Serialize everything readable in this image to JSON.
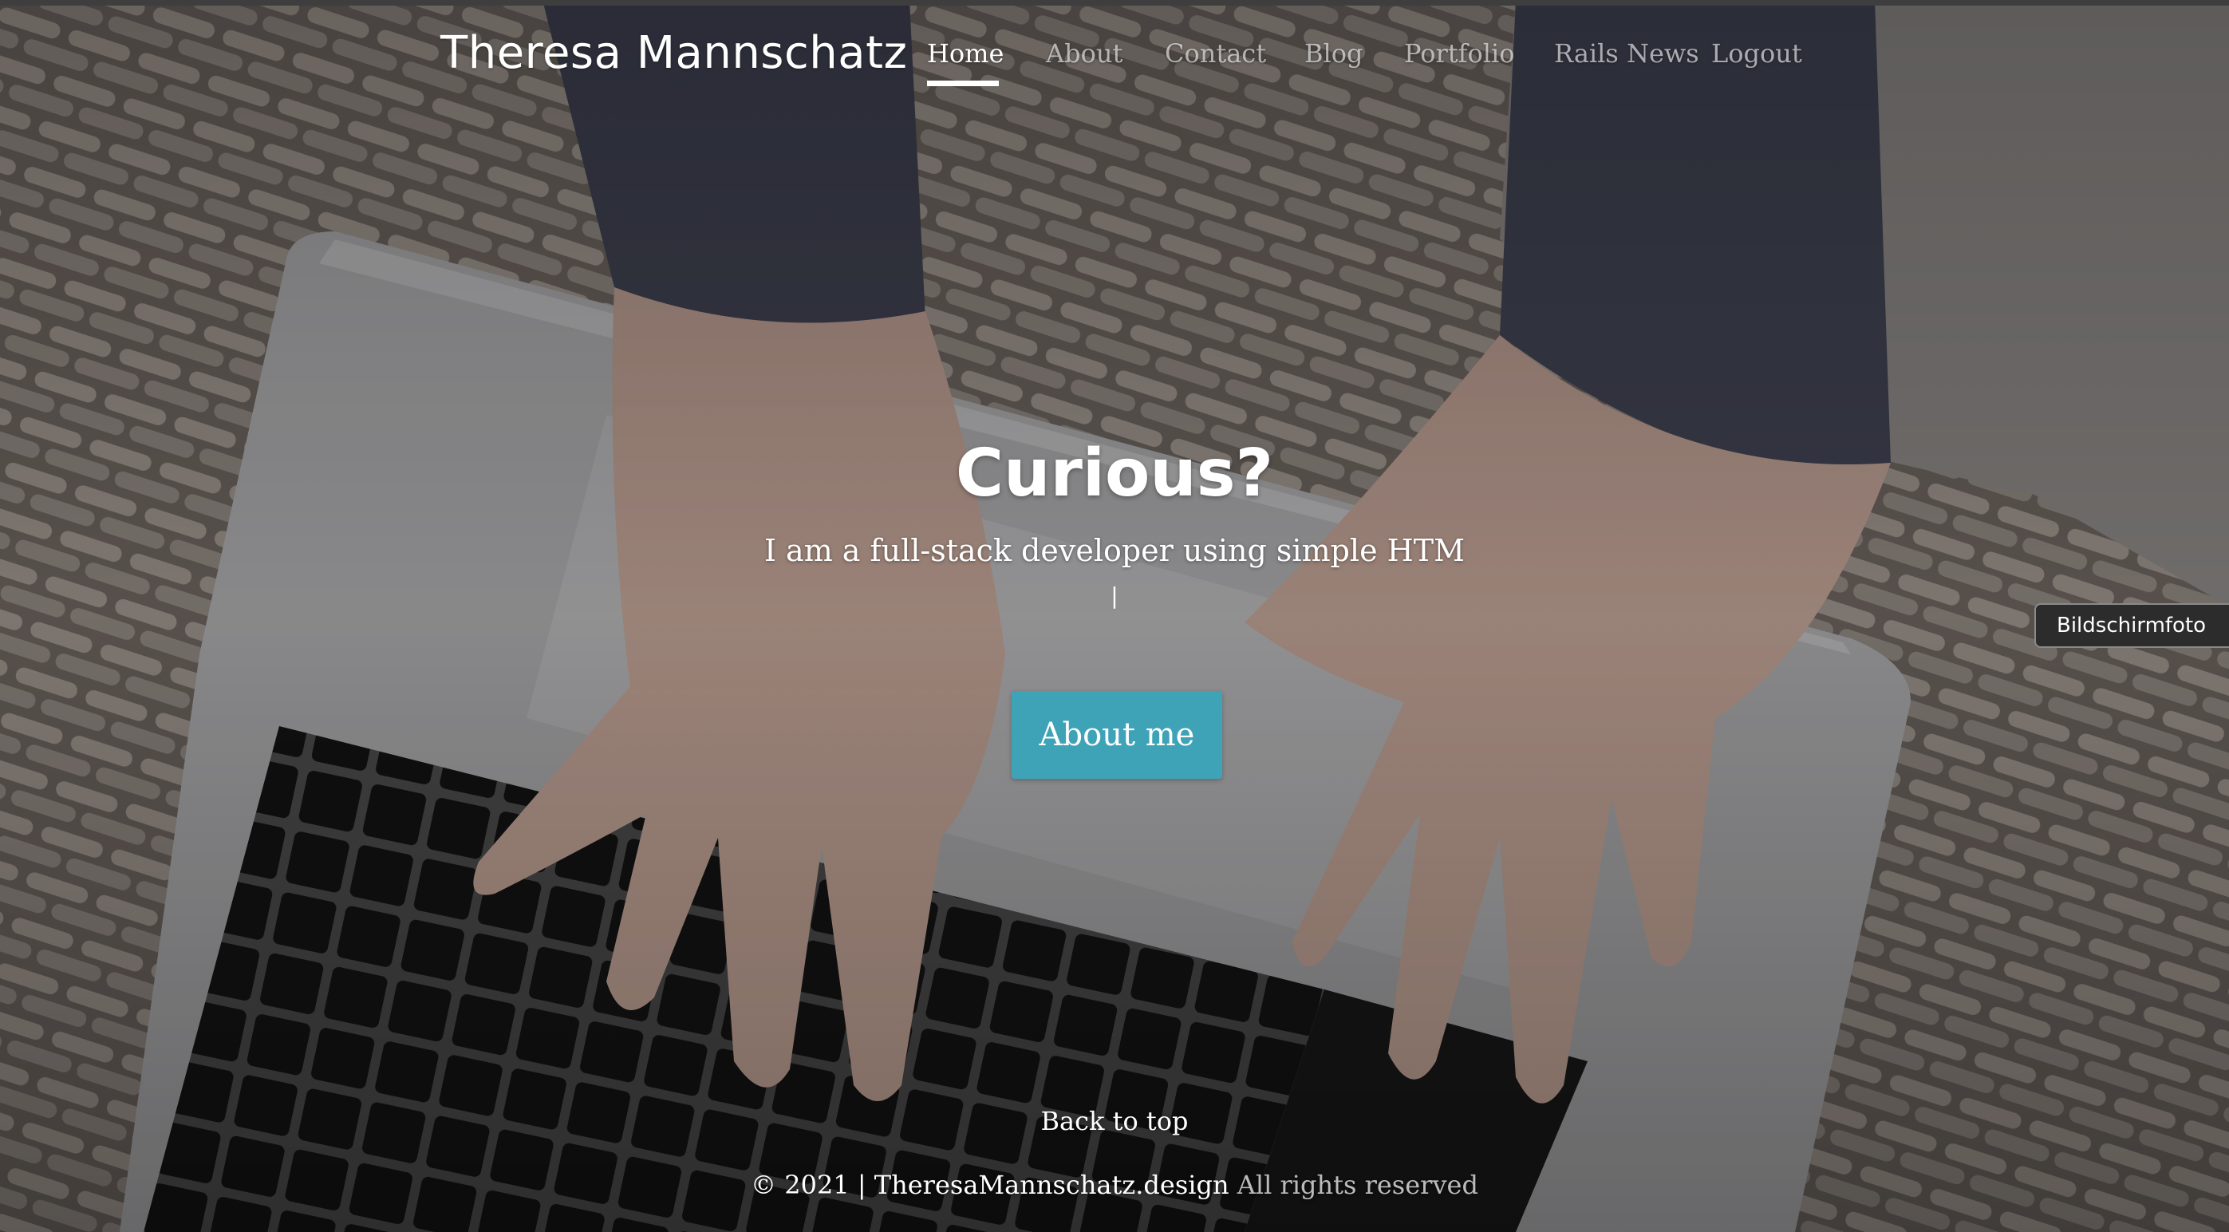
{
  "navbar": {
    "brand": "Theresa Mannschatz",
    "links": [
      {
        "label": "Home",
        "active": true
      },
      {
        "label": "About",
        "active": false
      },
      {
        "label": "Contact",
        "active": false
      },
      {
        "label": "Blog",
        "active": false
      },
      {
        "label": "Portfolio",
        "active": false
      },
      {
        "label": "Rails News",
        "active": false
      },
      {
        "label": "Logout",
        "active": false
      }
    ]
  },
  "hero": {
    "title": "Curious?",
    "subtitle": "I am a full-stack developer using simple HTM",
    "cursor": "|",
    "button_label": "About me",
    "background": "photo: hands typing on a laptop keyboard on a knitted blanket"
  },
  "footer": {
    "back_to_top": "Back to top",
    "copyright_prefix": "© 2021 | ",
    "site_name": "TheresaMannschatz.design",
    "copyright_suffix": " All rights reserved"
  },
  "overlay": {
    "tooltip": "Bildschirmfoto"
  },
  "colors": {
    "accent_button": "#3fa3b8",
    "text": "#ffffff"
  }
}
